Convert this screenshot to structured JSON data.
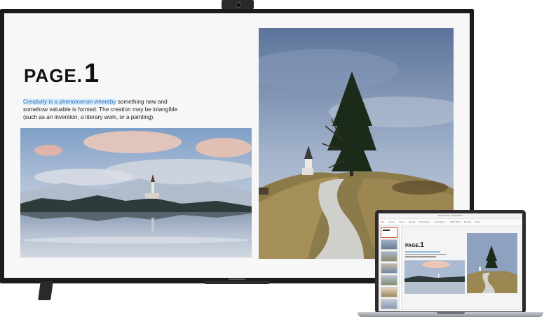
{
  "slide": {
    "page_word": "PAGE.",
    "page_number": "1",
    "highlighted_text": "Creativity is a phenomenon whereby",
    "paragraph_rest": " something new and somehow valuable is formed. The creation may be intangible (such as an invention, a literary work, or a painting)."
  },
  "laptop": {
    "window_title": "Presentation - PowerPoint",
    "ribbon_tabs": [
      "File",
      "Home",
      "Insert",
      "Design",
      "Transitions",
      "Animations",
      "Slide Show",
      "Review",
      "View"
    ],
    "active_tab": "File",
    "slide_count": 7,
    "selected_slide": 1
  },
  "colors": {
    "tv_frame": "#1b1b1d",
    "highlight_bg": "#d6ebfb",
    "highlight_text": "#1f6fb8",
    "ppt_accent": "#d35230"
  }
}
